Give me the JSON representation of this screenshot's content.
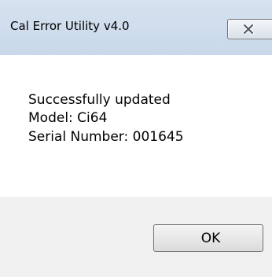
{
  "window": {
    "title": "Cal Error Utility v4.0",
    "close_icon": "close-icon"
  },
  "message": {
    "line1": "Successfully updated",
    "line2": "Model:  Ci64",
    "line3": "Serial Number:  001645"
  },
  "buttons": {
    "ok_label": "OK"
  }
}
